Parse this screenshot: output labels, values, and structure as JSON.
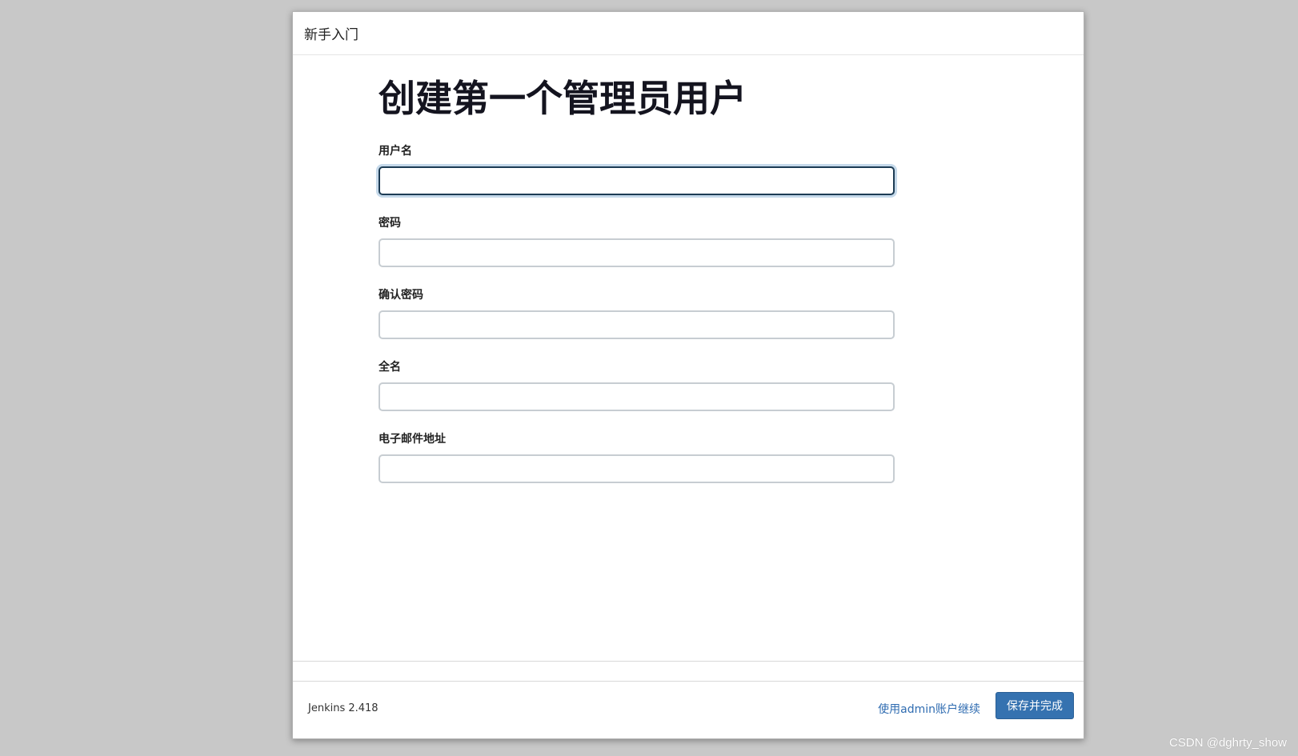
{
  "dialog": {
    "title": "新手入门"
  },
  "form": {
    "heading": "创建第一个管理员用户",
    "fields": [
      {
        "label": "用户名",
        "value": ""
      },
      {
        "label": "密码",
        "value": ""
      },
      {
        "label": "确认密码",
        "value": ""
      },
      {
        "label": "全名",
        "value": ""
      },
      {
        "label": "电子邮件地址",
        "value": ""
      }
    ]
  },
  "footer": {
    "version": "Jenkins 2.418",
    "continue_link": "使用admin账户继续",
    "save_button": "保存并完成"
  },
  "watermark": "CSDN @dghrty_show",
  "colors": {
    "primary_button": "#3572b0",
    "link": "#2f6cb1",
    "focus_border": "#1d3c54"
  }
}
